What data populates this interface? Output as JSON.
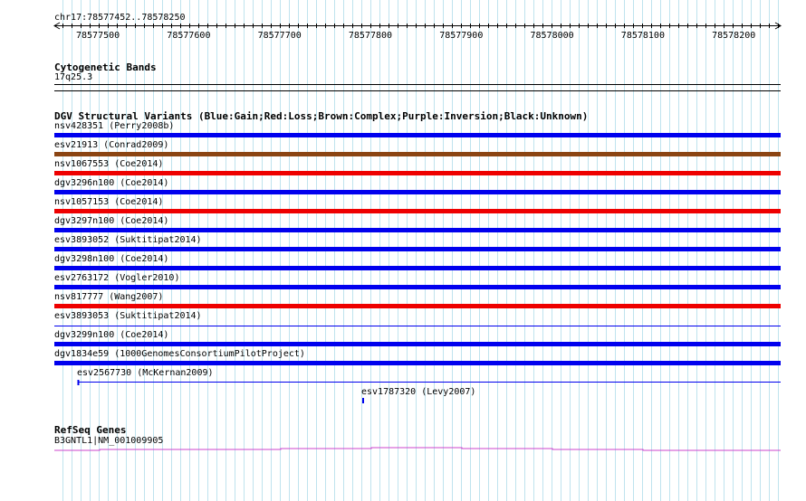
{
  "ruler": {
    "location": "chr17:78577452..78578250",
    "ticks": [
      "78577500",
      "78577600",
      "78577700",
      "78577800",
      "78577900",
      "78578000",
      "78578100",
      "78578200"
    ]
  },
  "cytobands": {
    "title": "Cytogenetic Bands",
    "band": "17q25.3"
  },
  "dgv": {
    "title": "DGV Structural Variants (Blue:Gain;Red:Loss;Brown:Complex;Purple:Inversion;Black:Unknown)",
    "colors": {
      "Gain": "#0000ee",
      "Loss": "#ee0000",
      "Complex": "#8b4513",
      "Inversion": "#800080",
      "Unknown": "#000000"
    },
    "variants": [
      {
        "label": "nsv428351 (Perry2008b)",
        "type": "Gain"
      },
      {
        "label": "esv21913 (Conrad2009)",
        "type": "Complex"
      },
      {
        "label": "nsv1067553 (Coe2014)",
        "type": "Loss"
      },
      {
        "label": "dgv3296n100 (Coe2014)",
        "type": "Gain"
      },
      {
        "label": "nsv1057153 (Coe2014)",
        "type": "Loss"
      },
      {
        "label": "dgv3297n100 (Coe2014)",
        "type": "Gain"
      },
      {
        "label": "esv3893052 (Suktitipat2014)",
        "type": "Gain"
      },
      {
        "label": "dgv3298n100 (Coe2014)",
        "type": "Gain"
      },
      {
        "label": "esv2763172 (Vogler2010)",
        "type": "Gain"
      },
      {
        "label": "nsv817777 (Wang2007)",
        "type": "Loss"
      },
      {
        "label": "esv3893053 (Suktitipat2014)",
        "type": "Gain"
      },
      {
        "label": "dgv3299n100 (Coe2014)",
        "type": "Gain"
      },
      {
        "label": "dgv1834e59 (1000GenomesConsortiumPilotProject)",
        "type": "Gain"
      },
      {
        "label": "esv2567730 (McKernan2009)",
        "type": "Gain"
      },
      {
        "label": "esv1787320 (Levy2007)",
        "type": "Gain"
      }
    ]
  },
  "refseq": {
    "title": "RefSeq Genes",
    "gene": "B3GNTL1|NM_001009905",
    "color": "#cc44cc"
  },
  "gridColor": "#bfe3ee"
}
